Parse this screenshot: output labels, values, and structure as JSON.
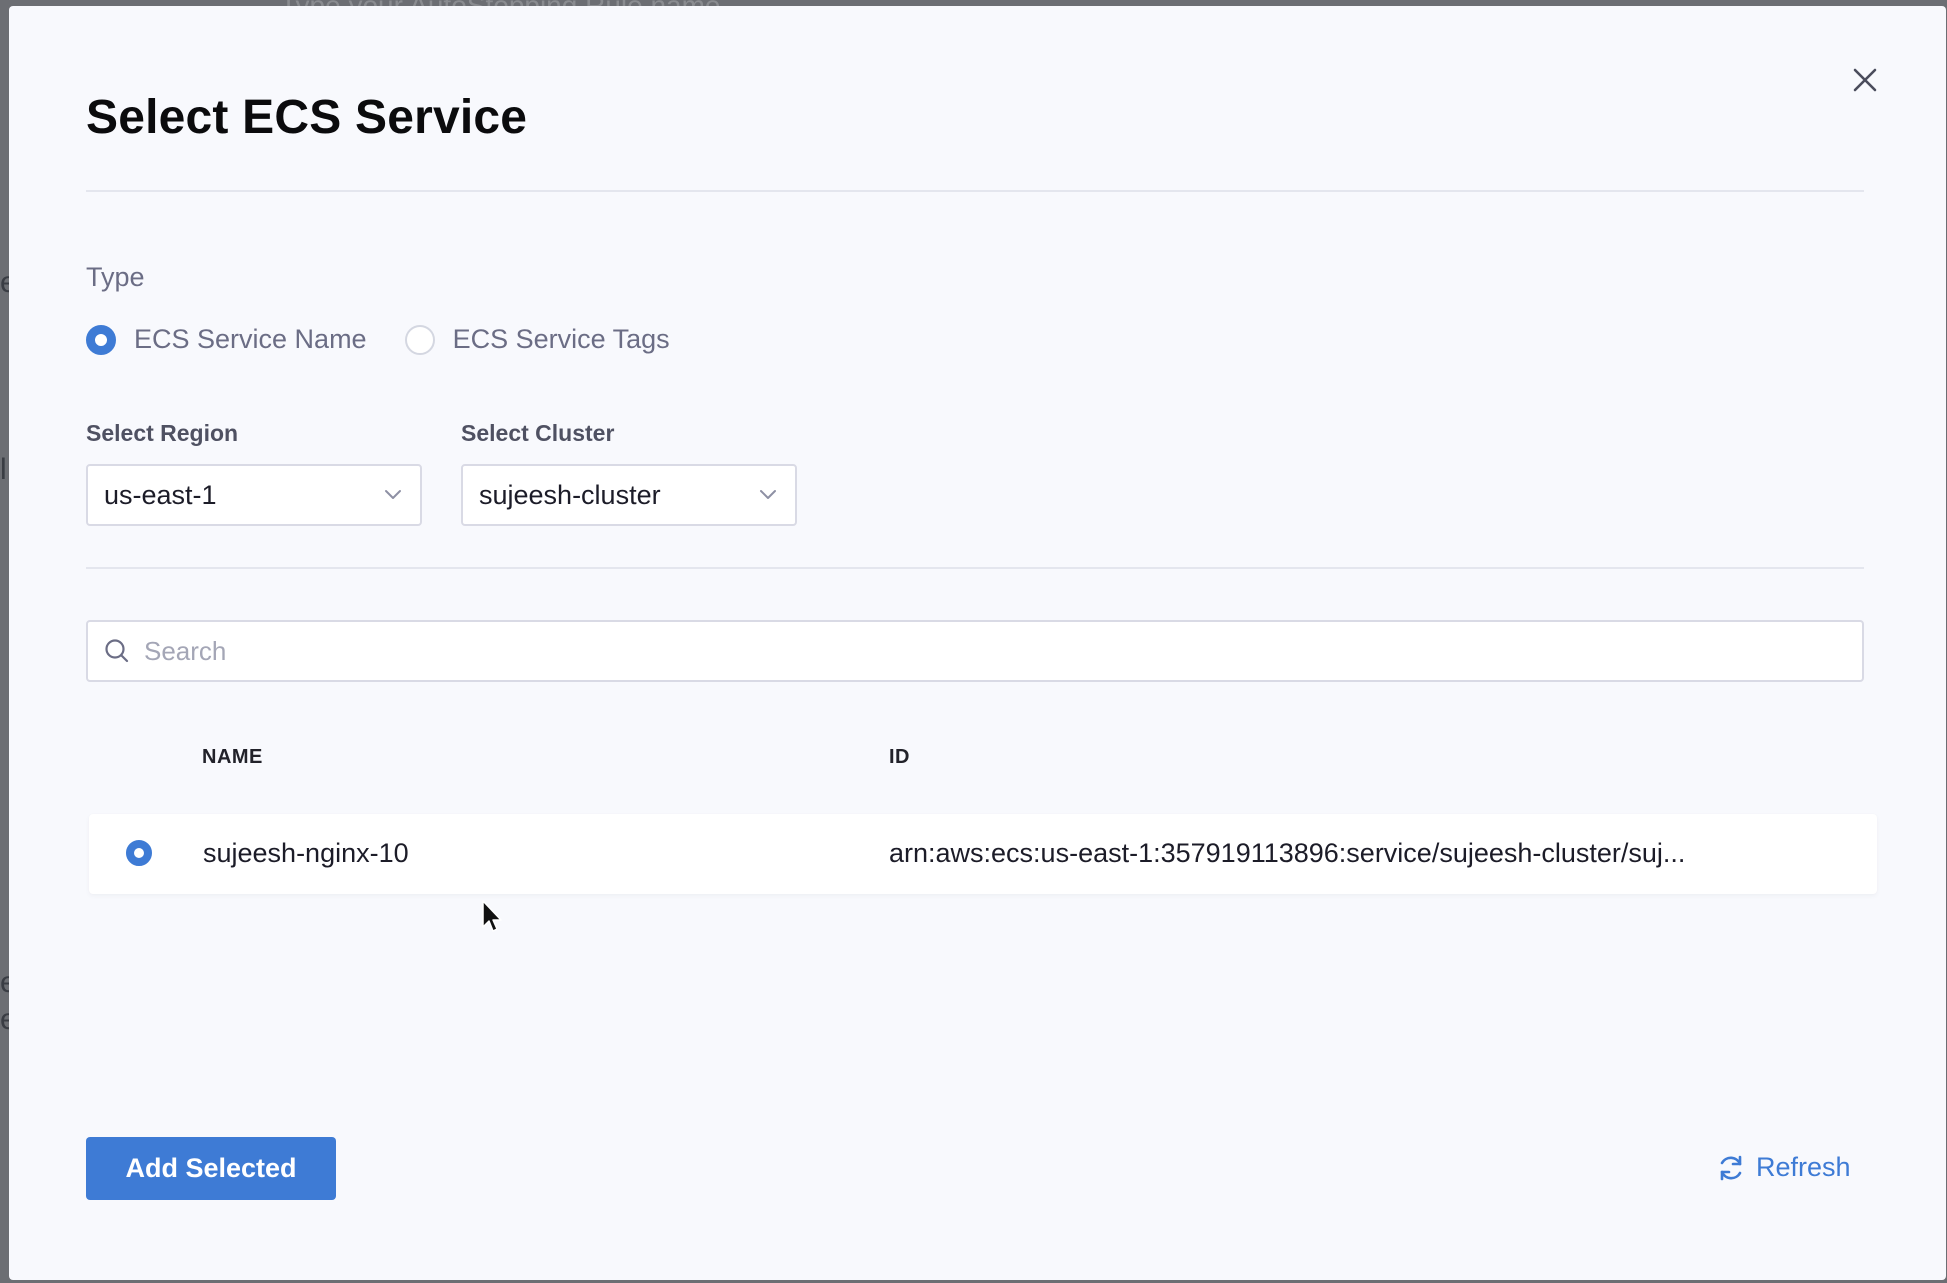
{
  "background": {
    "top_fragment": "Type your AutoStopping Rule name",
    "left_fragments": [
      "e",
      "l",
      "e",
      "e"
    ]
  },
  "dialog": {
    "title": "Select ECS Service",
    "close_icon": "close-icon"
  },
  "type_section": {
    "label": "Type",
    "options": [
      {
        "label": "ECS Service Name",
        "checked": true
      },
      {
        "label": "ECS Service Tags",
        "checked": false
      }
    ]
  },
  "region": {
    "label": "Select Region",
    "value": "us-east-1"
  },
  "cluster": {
    "label": "Select Cluster",
    "value": "sujeesh-cluster"
  },
  "search": {
    "placeholder": "Search",
    "value": ""
  },
  "table": {
    "columns": [
      "NAME",
      "ID"
    ],
    "rows": [
      {
        "selected": true,
        "name": "sujeesh-nginx-10",
        "id": "arn:aws:ecs:us-east-1:357919113896:service/sujeesh-cluster/suj..."
      }
    ]
  },
  "footer": {
    "add_label": "Add Selected",
    "refresh_label": "Refresh",
    "refresh_icon": "refresh-icon"
  },
  "colors": {
    "accent": "#3e7bd5",
    "modal_bg": "#f8f9fd",
    "muted_text": "#6b6d85"
  }
}
